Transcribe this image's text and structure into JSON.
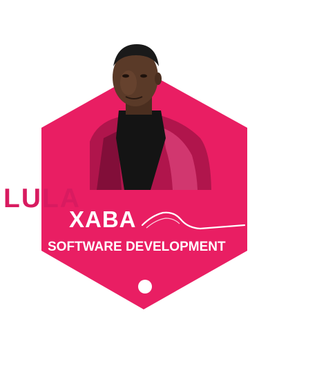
{
  "logo": {
    "first_name": "LULA",
    "last_name": "XABA",
    "tagline": "SOFTWARE DEVELOPMENT",
    "icons": [
      "portrait-image",
      "wave-swoosh-icon",
      "dot-icon"
    ]
  },
  "colors": {
    "hexagon": "#e91e63",
    "first_name_text": "#d81b60",
    "white_text": "#ffffff",
    "jacket": "#b0154c",
    "sweater": "#121212",
    "skin": "#5a3a28",
    "background": "#ffffff"
  }
}
